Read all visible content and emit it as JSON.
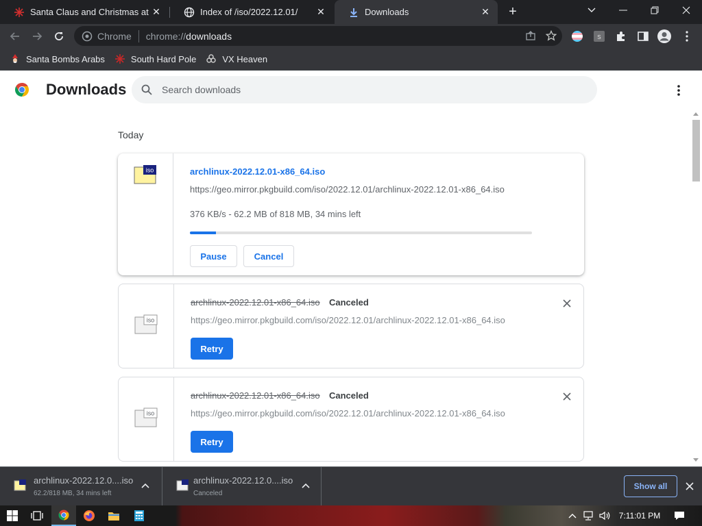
{
  "window": {
    "tabs": [
      {
        "title": "Santa Claus and Christmas at the",
        "icon": "red-snowflake-icon",
        "active": false
      },
      {
        "title": "Index of /iso/2022.12.01/",
        "icon": "globe-icon",
        "active": false
      },
      {
        "title": "Downloads",
        "icon": "download-arrow-icon",
        "active": true
      }
    ]
  },
  "toolbar": {
    "omnibox_label": "Chrome",
    "url_scheme": "chrome://",
    "url_host": "downloads"
  },
  "bookmarks": [
    {
      "label": "Santa Bombs Arabs",
      "icon": "santa-icon"
    },
    {
      "label": "South Hard Pole",
      "icon": "red-snowflake-icon"
    },
    {
      "label": "VX Heaven",
      "icon": "biohazard-icon"
    }
  ],
  "page": {
    "title": "Downloads",
    "search_placeholder": "Search downloads",
    "date_group": "Today",
    "items": [
      {
        "filename": "archlinux-2022.12.01-x86_64.iso",
        "url": "https://geo.mirror.pkgbuild.com/iso/2022.12.01/archlinux-2022.12.01-x86_64.iso",
        "progress_text": "376 KB/s - 62.2 MB of 818 MB, 34 mins left",
        "progress_fraction": 0.076,
        "buttons": [
          "Pause",
          "Cancel"
        ],
        "state": "in-progress"
      },
      {
        "filename": "archlinux-2022.12.01-x86_64.iso",
        "status": "Canceled",
        "url": "https://geo.mirror.pkgbuild.com/iso/2022.12.01/archlinux-2022.12.01-x86_64.iso",
        "button": "Retry",
        "state": "canceled"
      },
      {
        "filename": "archlinux-2022.12.01-x86_64.iso",
        "status": "Canceled",
        "url": "https://geo.mirror.pkgbuild.com/iso/2022.12.01/archlinux-2022.12.01-x86_64.iso",
        "button": "Retry",
        "state": "canceled"
      }
    ]
  },
  "shelf": {
    "items": [
      {
        "name": "archlinux-2022.12.0....iso",
        "sub": "62.2/818 MB, 34 mins left"
      },
      {
        "name": "archlinux-2022.12.0....iso",
        "sub": "Canceled"
      }
    ],
    "show_all": "Show all"
  },
  "taskbar": {
    "clock": "7:11:01 PM"
  },
  "colors": {
    "accent": "#1a73e8",
    "dark_chrome": "#202124",
    "toolbar": "#35363a"
  }
}
